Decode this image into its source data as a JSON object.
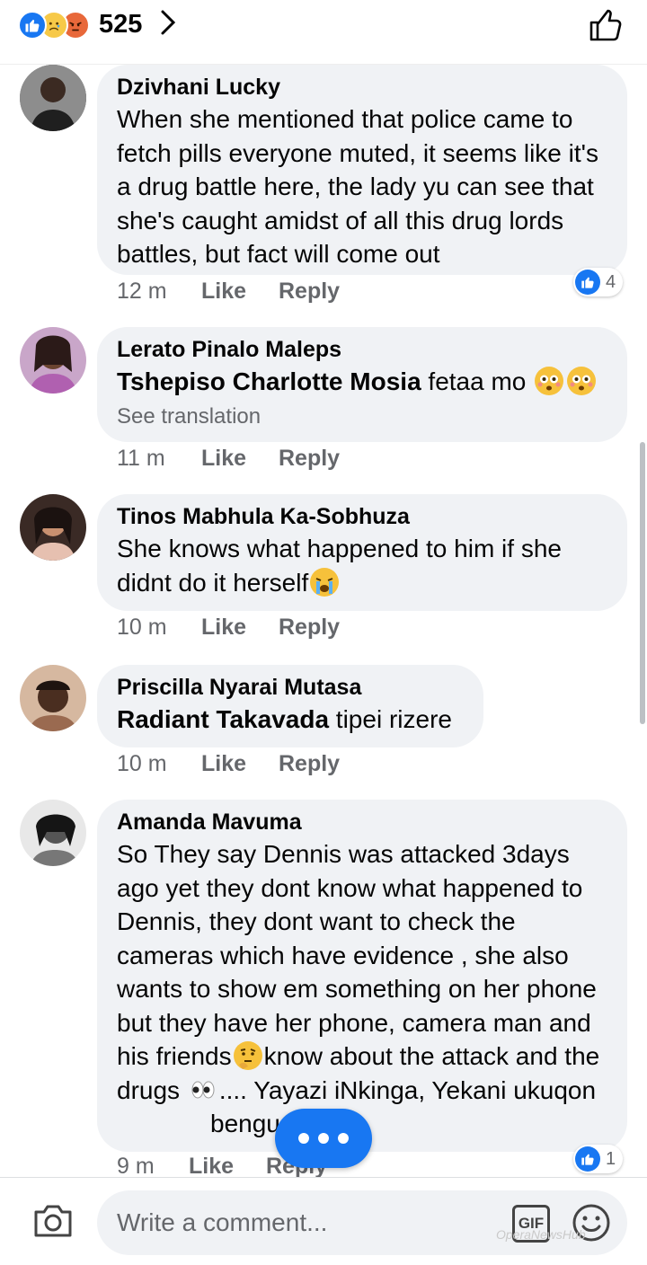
{
  "reactions": {
    "icons": [
      "like-icon",
      "sad-icon",
      "angry-icon"
    ],
    "count": "525"
  },
  "comments": [
    {
      "author": "Dzivhani Lucky",
      "text": "When she mentioned that police came to fetch pills everyone muted, it seems like it's a drug battle here, the lady yu can see that she's caught amidst of all this drug lords battles, but fact will come out",
      "time": "12 m",
      "like": "Like",
      "reply": "Reply",
      "reaction_count": "4"
    },
    {
      "author": "Lerato Pinalo Maleps",
      "mention": "Tshepiso Charlotte Mosia",
      "text": " fetaa mo",
      "see_translation": "See translation",
      "time": "11 m",
      "like": "Like",
      "reply": "Reply"
    },
    {
      "author": "Tinos Mabhula Ka-Sobhuza",
      "text": "She knows what happened to him if she didnt do it herself",
      "time": "10 m",
      "like": "Like",
      "reply": "Reply"
    },
    {
      "author": "Priscilla Nyarai Mutasa",
      "mention": "Radiant Takavada",
      "text": " tipei rizere",
      "time": "10 m",
      "like": "Like",
      "reply": "Reply"
    },
    {
      "author": "Amanda Mavuma",
      "text_a": "So They say Dennis was attacked 3days ago yet they dont know what happened to Dennis, they dont want to check the cameras which have evidence , she also wants to show em something on her phone but they have her phone, camera man and his friends",
      "text_b": "know about the attack and the drugs",
      "text_c": ".... Yayazi iNkinga, Yekani ukuqon",
      "text_d": "bengu",
      "text_e": "!!",
      "time": "9 m",
      "like": "Like",
      "reply": "Reply",
      "reaction_count": "1"
    }
  ],
  "composer": {
    "placeholder": "Write a comment...",
    "gif_label": "GIF"
  },
  "watermark": "OperaNewsHub",
  "colors": {
    "accent": "#1877f2",
    "bubble": "#f0f2f5",
    "meta": "#65676b"
  }
}
